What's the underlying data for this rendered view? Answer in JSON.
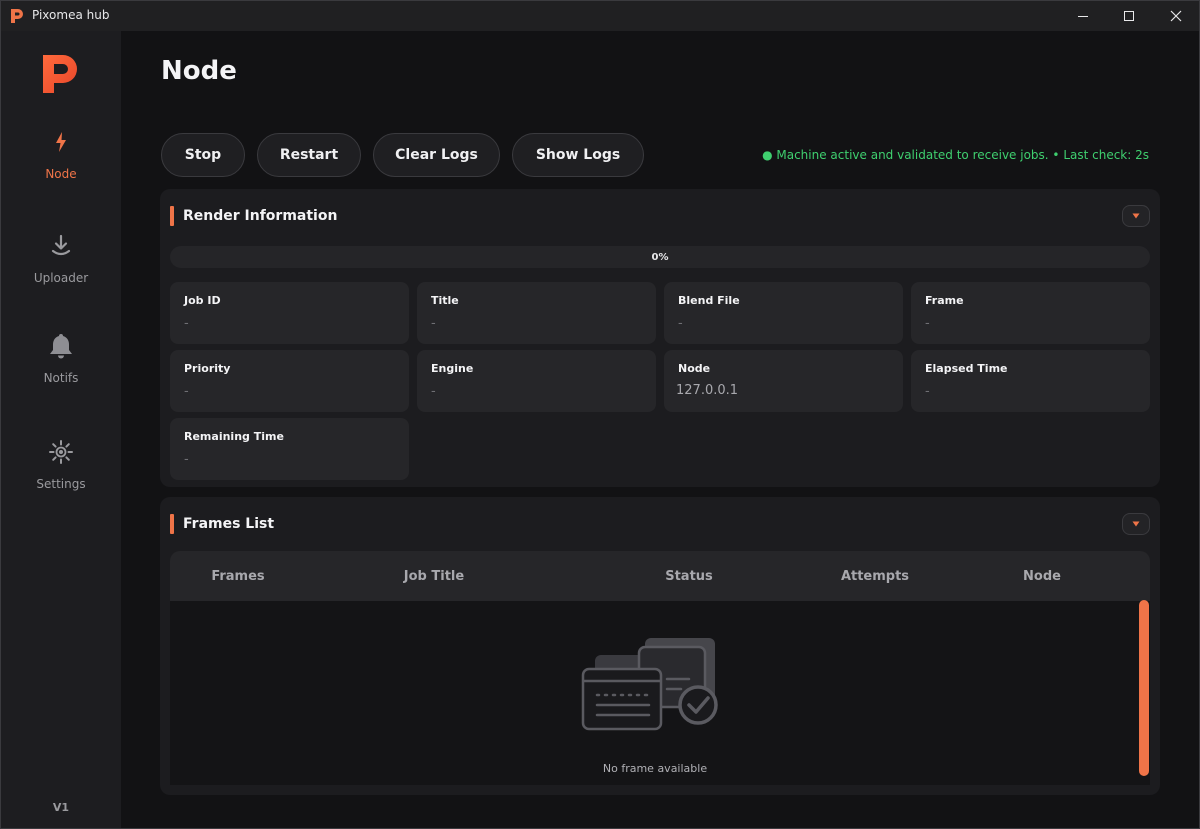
{
  "window": {
    "title": "Pixomea hub",
    "accent_color": "#ef7448"
  },
  "sidebar": {
    "items": [
      {
        "label": "Node",
        "icon": "lightning-icon",
        "active": true
      },
      {
        "label": "Uploader",
        "icon": "download-icon",
        "active": false
      },
      {
        "label": "Notifs",
        "icon": "bell-icon",
        "active": false
      },
      {
        "label": "Settings",
        "icon": "gear-icon",
        "active": false
      }
    ],
    "version": "V1"
  },
  "header": {
    "title": "Node"
  },
  "toolbar": {
    "stop_label": "Stop",
    "restart_label": "Restart",
    "clear_logs_label": "Clear Logs",
    "show_logs_label": "Show Logs",
    "status_text": "● Machine active and validated to receive jobs.  •  Last check: 2s",
    "status_color": "#3fcf6f"
  },
  "render_info": {
    "title": "Render Information",
    "progress_label": "0%",
    "progress_value": 0,
    "fields": [
      {
        "label": "Job ID",
        "value": "-"
      },
      {
        "label": "Title",
        "value": "-"
      },
      {
        "label": "Blend File",
        "value": "-"
      },
      {
        "label": "Frame",
        "value": "-"
      },
      {
        "label": "Priority",
        "value": "-"
      },
      {
        "label": "Engine",
        "value": "-"
      },
      {
        "label": "Node",
        "value": "127.0.0.1"
      },
      {
        "label": "Elapsed Time",
        "value": "-"
      },
      {
        "label": "Remaining Time",
        "value": "-"
      }
    ]
  },
  "frames_list": {
    "title": "Frames List",
    "columns": [
      "Frames",
      "Job Title",
      "Status",
      "Attempts",
      "Node"
    ],
    "empty_text": "No frame available"
  }
}
